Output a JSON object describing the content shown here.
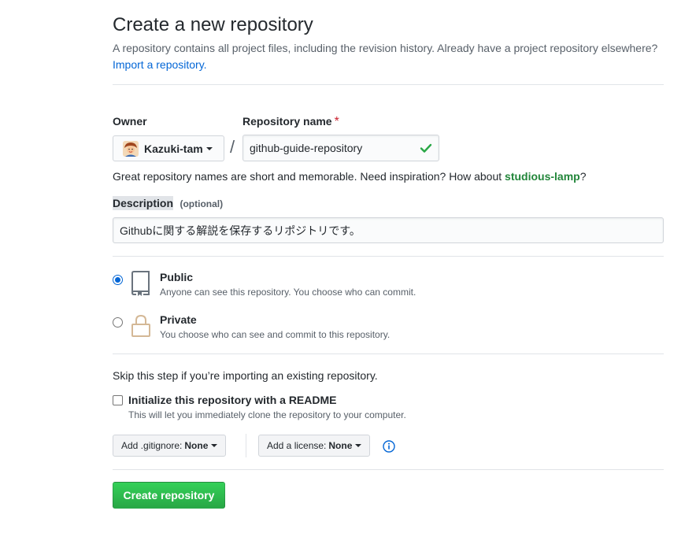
{
  "header": {
    "title": "Create a new repository",
    "lead_text": "A repository contains all project files, including the revision history. Already have a project repository elsewhere?",
    "import_link": "Import a repository."
  },
  "owner": {
    "label": "Owner",
    "value": "Kazuki-tam",
    "avatar_icon": "user-avatar"
  },
  "repo_name": {
    "label": "Repository name",
    "required_mark": "*",
    "value": "github-guide-repository",
    "separator": "/",
    "valid_icon": "check-icon"
  },
  "name_hint": {
    "text": "Great repository names are short and memorable. Need inspiration? How about",
    "suggestion": "studious-lamp",
    "suffix": "?"
  },
  "description": {
    "label": "Description",
    "optional_text": "(optional)",
    "value": "Githubに関する解説を保存するリポジトリです。"
  },
  "visibility": {
    "options": [
      {
        "title": "Public",
        "note": "Anyone can see this repository. You choose who can commit.",
        "selected": true,
        "icon": "repo-icon"
      },
      {
        "title": "Private",
        "note": "You choose who can see and commit to this repository.",
        "selected": false,
        "icon": "lock-icon"
      }
    ]
  },
  "init": {
    "skip_text": "Skip this step if you’re importing an existing repository.",
    "readme_label": "Initialize this repository with a README",
    "readme_note": "This will let you immediately clone the repository to your computer.",
    "readme_checked": false
  },
  "addons": {
    "gitignore_prefix": "Add .gitignore:",
    "gitignore_value": "None",
    "license_prefix": "Add a license:",
    "license_value": "None",
    "info_icon": "info-icon"
  },
  "submit": {
    "label": "Create repository"
  },
  "colors": {
    "link": "#0366d6",
    "suggestion": "#22863a",
    "required": "#cb2431",
    "primary_button": "#28a745",
    "valid_check": "#28a745"
  }
}
